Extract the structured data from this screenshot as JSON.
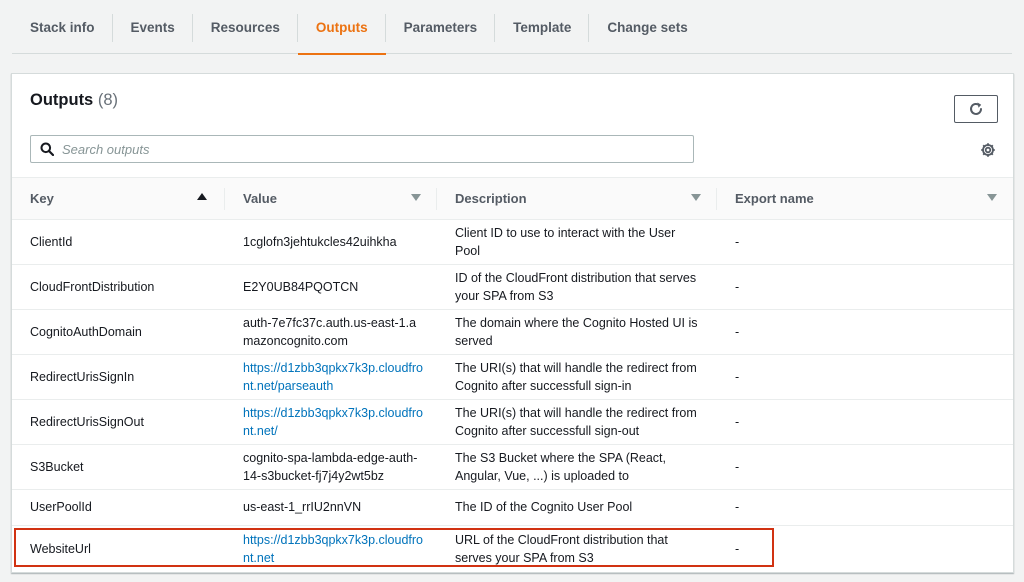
{
  "tabs": [
    {
      "label": "Stack info",
      "active": false
    },
    {
      "label": "Events",
      "active": false
    },
    {
      "label": "Resources",
      "active": false
    },
    {
      "label": "Outputs",
      "active": true
    },
    {
      "label": "Parameters",
      "active": false
    },
    {
      "label": "Template",
      "active": false
    },
    {
      "label": "Change sets",
      "active": false
    }
  ],
  "panel": {
    "title": "Outputs",
    "count": "(8)",
    "refresh_icon": "refresh-icon",
    "settings_icon": "gear-icon"
  },
  "search": {
    "placeholder": "Search outputs",
    "value": ""
  },
  "table": {
    "columns": [
      {
        "label": "Key",
        "sort": "ascending"
      },
      {
        "label": "Value",
        "sort": "none"
      },
      {
        "label": "Description",
        "sort": "none"
      },
      {
        "label": "Export name",
        "sort": "none"
      }
    ],
    "rows": [
      {
        "key": "ClientId",
        "value": "1cglofn3jehtukcles42uihkha",
        "value_is_link": false,
        "description": "Client ID to use to interact with the User Pool",
        "export": "-"
      },
      {
        "key": "CloudFrontDistribution",
        "value": "E2Y0UB84PQOTCN",
        "value_is_link": false,
        "description": "ID of the CloudFront distribution that serves your SPA from S3",
        "export": "-"
      },
      {
        "key": "CognitoAuthDomain",
        "value": "auth-7e7fc37c.auth.us-east-1.amazoncognito.com",
        "value_is_link": false,
        "description": "The domain where the Cognito Hosted UI is served",
        "export": "-"
      },
      {
        "key": "RedirectUrisSignIn",
        "value": "https://d1zbb3qpkx7k3p.cloudfront.net/parseauth",
        "value_is_link": true,
        "description": "The URI(s) that will handle the redirect from Cognito after successfull sign-in",
        "export": "-"
      },
      {
        "key": "RedirectUrisSignOut",
        "value": "https://d1zbb3qpkx7k3p.cloudfront.net/",
        "value_is_link": true,
        "description": "The URI(s) that will handle the redirect from Cognito after successfull sign-out",
        "export": "-"
      },
      {
        "key": "S3Bucket",
        "value": "cognito-spa-lambda-edge-auth-14-s3bucket-fj7j4y2wt5bz",
        "value_is_link": false,
        "description": "The S3 Bucket where the SPA (React, Angular, Vue, ...) is uploaded to",
        "export": "-"
      },
      {
        "key": "UserPoolId",
        "value": "us-east-1_rrIU2nnVN",
        "value_is_link": false,
        "description": "The ID of the Cognito User Pool",
        "export": "-"
      },
      {
        "key": "WebsiteUrl",
        "value": "https://d1zbb3qpkx7k3p.cloudfront.net",
        "value_is_link": true,
        "description": "URL of the CloudFront distribution that serves your SPA from S3",
        "export": "-",
        "highlighted": true
      }
    ]
  },
  "colors": {
    "accent": "#ec7211",
    "link": "#0073bb",
    "highlight_border": "#d13212"
  }
}
